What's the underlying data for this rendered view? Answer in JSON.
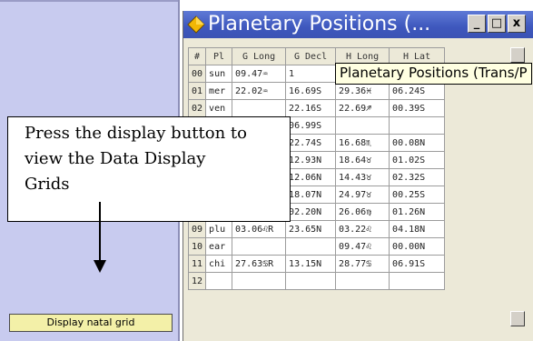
{
  "left_panel": {
    "display_button_label": "Display natal grid"
  },
  "window": {
    "title": "Planetary Positions (...",
    "buttons": {
      "minimize": "_",
      "maximize": "□",
      "close": "x"
    },
    "icon": "diamond-app-icon"
  },
  "grid": {
    "headers": [
      "#",
      "Pl",
      "G Long",
      "G Decl",
      "H Long",
      "H Lat"
    ],
    "rows": [
      [
        "00",
        "sun",
        "09.47♒",
        "1",
        "",
        ""
      ],
      [
        "01",
        "mer",
        "22.02♒",
        "16.69S",
        "29.36♓",
        "06.24S"
      ],
      [
        "02",
        "ven",
        "",
        "22.16S",
        "22.69♐",
        "00.39S"
      ],
      [
        "03",
        "mar",
        "",
        "06.99S",
        "",
        ""
      ],
      [
        "04",
        "jup",
        "",
        "22.74S",
        "16.68♏",
        "00.08N"
      ],
      [
        "05",
        "sat",
        "",
        "12.93N",
        "18.64♉",
        "01.02S"
      ],
      [
        "06",
        "ura",
        "",
        "12.06N",
        "14.43♉",
        "02.32S"
      ],
      [
        "07",
        "ura",
        "22.15♉R",
        "18.07N",
        "24.97♉",
        "00.25S"
      ],
      [
        "08",
        "nep",
        "27.44♍R",
        "02.20N",
        "26.06♍",
        "01.26N"
      ],
      [
        "09",
        "plu",
        "03.06♌R",
        "23.65N",
        "03.22♌",
        "04.18N"
      ],
      [
        "10",
        "ear",
        "",
        "",
        "09.47♌",
        "00.00N"
      ],
      [
        "11",
        "chi",
        "27.63♋R",
        "13.15N",
        "28.77♋",
        "06.91S"
      ],
      [
        "12",
        "",
        "",
        "",
        "",
        ""
      ]
    ]
  },
  "tooltip": "Planetary Positions (Trans/P",
  "callout": {
    "line1": "Press the display button to",
    "line2": "view the Data Display",
    "line3": "Grids"
  },
  "colors": {
    "titlebar": "#3e57bd",
    "left_panel": "#c8cbef",
    "button": "#f3f0a8",
    "tooltip": "#ffffe1"
  }
}
